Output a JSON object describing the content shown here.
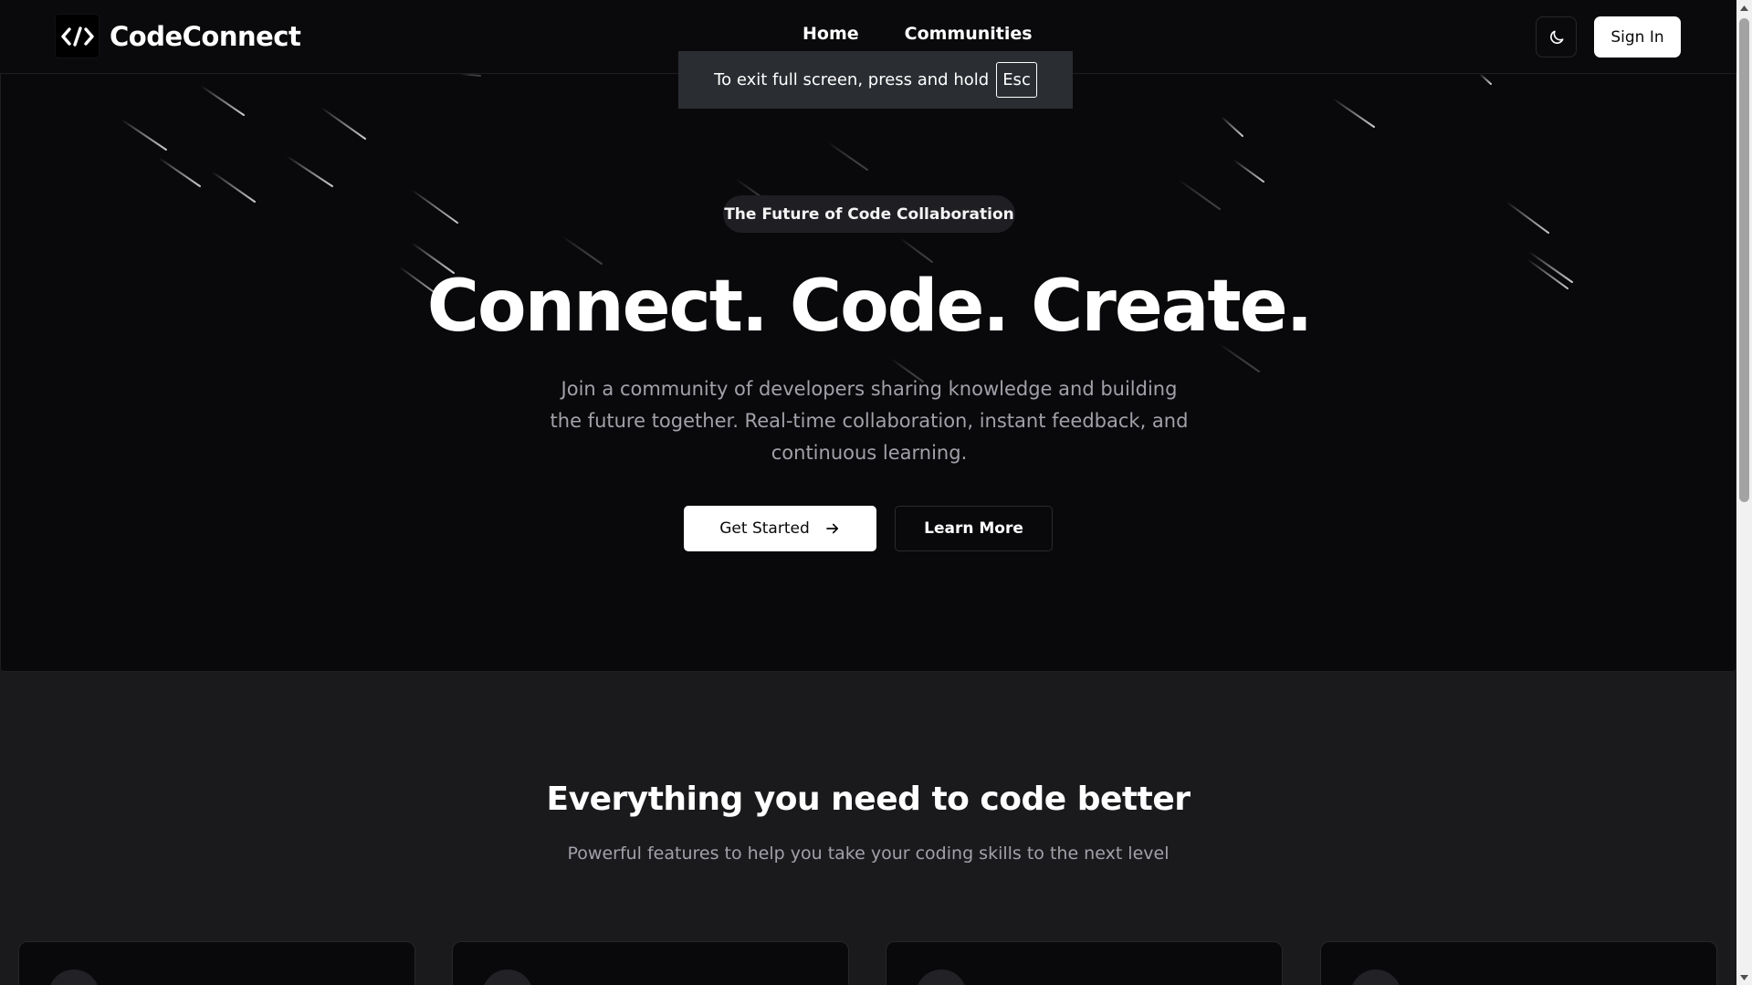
{
  "header": {
    "brand": "CodeConnect",
    "nav": [
      {
        "label": "Home"
      },
      {
        "label": "Communities"
      }
    ],
    "theme_toggle_icon": "moon-icon",
    "signin_label": "Sign In"
  },
  "fullscreen_toast": {
    "text": "To exit full screen, press and hold",
    "key": "Esc"
  },
  "hero": {
    "badge": "The Future of Code Collaboration",
    "title": "Connect. Code. Create.",
    "subtitle": "Join a community of developers sharing knowledge and building the future together. Real-time collaboration, instant feedback, and continuous learning.",
    "primary_cta": "Get Started",
    "primary_cta_icon": "arrow-right-icon",
    "secondary_cta": "Learn More"
  },
  "features": {
    "title": "Everything you need to code better",
    "subtitle": "Powerful features to help you take your coding skills to the next level"
  },
  "colors": {
    "hero_bg": "#09090b",
    "page_bg": "#1a1a1d",
    "muted_text": "#a1a1aa",
    "accent": "#ffffff"
  }
}
